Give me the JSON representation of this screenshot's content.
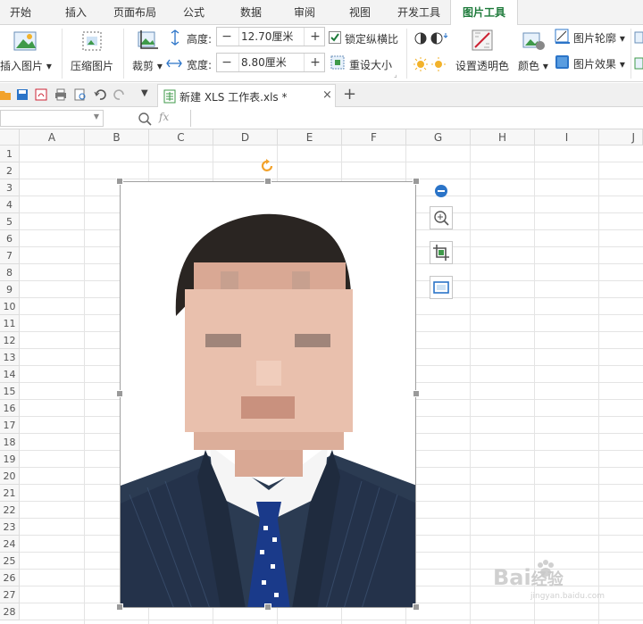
{
  "tabs": [
    "开始",
    "插入",
    "页面布局",
    "公式",
    "数据",
    "审阅",
    "视图",
    "开发工具",
    "图片工具"
  ],
  "ribbon": {
    "insert_picture": "插入图片",
    "compress_picture": "压缩图片",
    "crop": "裁剪",
    "height_label": "高度:",
    "height_value": "12.70厘米",
    "width_label": "宽度:",
    "width_value": "8.80厘米",
    "lock_ratio": "锁定纵横比",
    "reset_size": "重设大小",
    "set_transparent": "设置透明色",
    "color": "颜色",
    "picture_outline": "图片轮廓",
    "picture_effect": "图片效果"
  },
  "doc_tab": {
    "title": "新建 XLS 工作表.xls *"
  },
  "formula": {
    "fx": "fx"
  },
  "columns": [
    "A",
    "B",
    "C",
    "D",
    "E",
    "F",
    "G",
    "H",
    "I",
    "J"
  ],
  "rows": [
    "1",
    "2",
    "3",
    "4",
    "5",
    "6",
    "7",
    "8",
    "9",
    "10",
    "11",
    "12",
    "13",
    "14",
    "15",
    "16",
    "17",
    "18",
    "19",
    "20",
    "21",
    "22",
    "23",
    "24",
    "25",
    "26",
    "27",
    "28"
  ],
  "watermark": {
    "text": "Bai",
    "suffix": "经验",
    "sub": "jingyan.baidu.com"
  },
  "colors": {
    "active_tab": "#1d7a3a",
    "suit": "#2b3b52",
    "tie": "#1a3a8a",
    "hair": "#2a2522",
    "skin": "#e9c0ad",
    "accent_blue": "#2b74c8"
  }
}
